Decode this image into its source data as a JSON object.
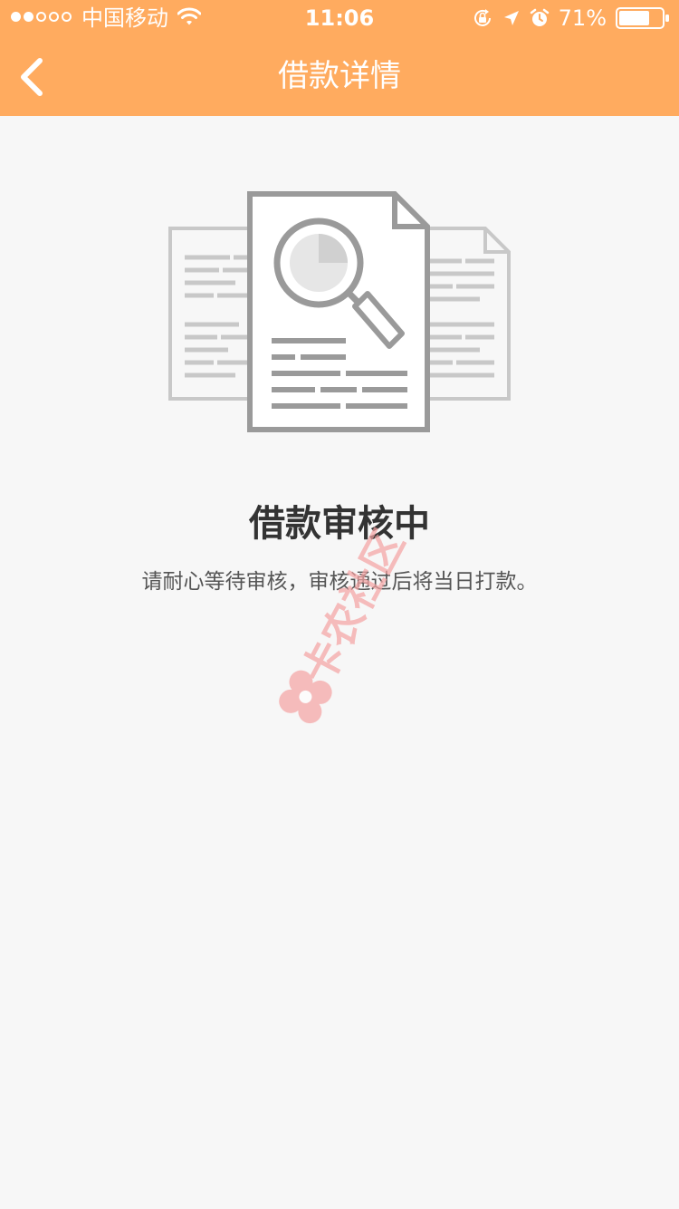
{
  "status_bar": {
    "carrier": "中国移动",
    "time": "11:06",
    "battery": "71%",
    "signal_strength": {
      "filled": 2,
      "total": 5
    },
    "battery_level": 0.71
  },
  "nav": {
    "title": "借款详情",
    "back_icon": "chevron-left-icon"
  },
  "main": {
    "status_title": "借款审核中",
    "status_desc": "请耐心等待审核，审核通过后将当日打款。",
    "illustration_icon": "document-magnifier-icon"
  },
  "watermark": {
    "text": "卡农社区"
  },
  "colors": {
    "header": "#ffab5f",
    "background": "#f7f7f7",
    "title_text": "#333333",
    "desc_text": "#555555",
    "watermark": "#f5a3a3"
  }
}
